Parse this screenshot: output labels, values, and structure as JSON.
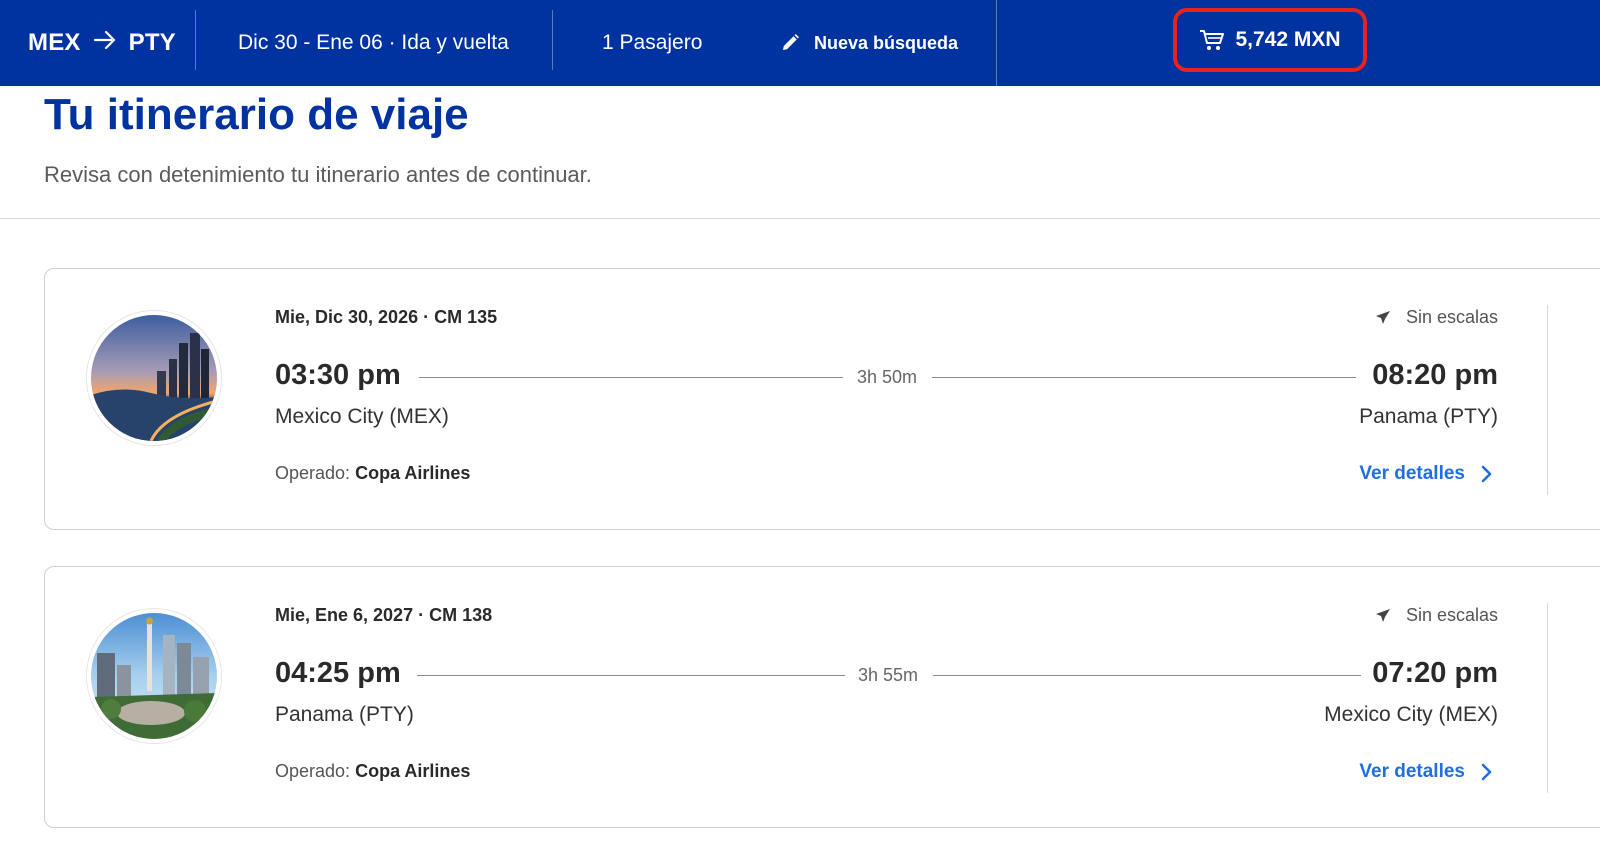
{
  "topbar": {
    "origin": "MEX",
    "destination": "PTY",
    "dates": "Dic 30 - Ene 06 · Ida y vuelta",
    "passengers": "1 Pasajero",
    "new_search": "Nueva búsqueda",
    "cart_total": "5,742 MXN"
  },
  "header": {
    "title": "Tu itinerario de viaje",
    "subtitle": "Revisa con detenimiento tu itinerario antes de continuar."
  },
  "flights": [
    {
      "date_flight": "Mie, Dic 30, 2026 · CM 135",
      "stops": "Sin escalas",
      "departure_time": "03:30 pm",
      "arrival_time": "08:20 pm",
      "duration": "3h 50m",
      "departure_city": "Mexico City (MEX)",
      "arrival_city": "Panama (PTY)",
      "operated_label": "Operado:",
      "operator": "Copa Airlines",
      "details_label": "Ver detalles"
    },
    {
      "date_flight": "Mie, Ene 6, 2027 · CM 138",
      "stops": "Sin escalas",
      "departure_time": "04:25 pm",
      "arrival_time": "07:20 pm",
      "duration": "3h 55m",
      "departure_city": "Panama (PTY)",
      "arrival_city": "Mexico City (MEX)",
      "operated_label": "Operado:",
      "operator": "Copa Airlines",
      "details_label": "Ver detalles"
    }
  ],
  "colors": {
    "brand_blue": "#0032a0",
    "highlight_red": "#e8231f",
    "link_blue": "#1f6fe0"
  }
}
